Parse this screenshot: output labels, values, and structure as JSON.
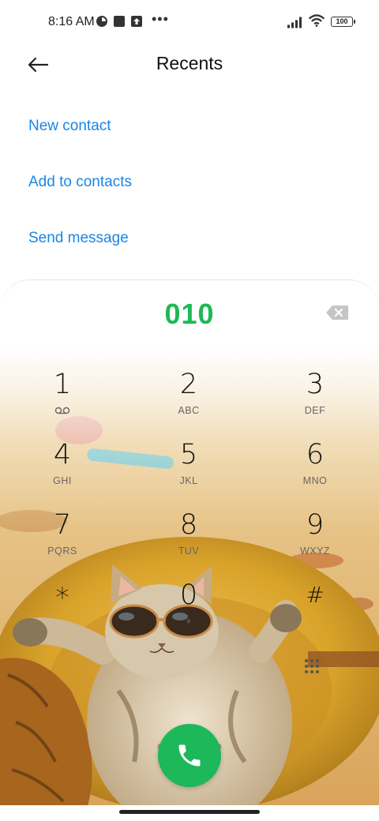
{
  "status_bar": {
    "time": "8:16 AM",
    "notification_icons": [
      "data-saver-icon",
      "square-notification-icon",
      "upload-icon"
    ],
    "more": "•••",
    "signal_icon": "cellular-signal-icon",
    "wifi_icon": "wifi-icon",
    "battery": "100"
  },
  "header": {
    "back_icon": "back-arrow-icon",
    "title": "Recents"
  },
  "actions": [
    {
      "label": "New contact"
    },
    {
      "label": "Add to contacts"
    },
    {
      "label": "Send message"
    }
  ],
  "dialer": {
    "number": "010",
    "backspace_icon": "backspace-icon",
    "keys": [
      {
        "digit": "1",
        "letters": "⌕"
      },
      {
        "digit": "2",
        "letters": "ABC"
      },
      {
        "digit": "3",
        "letters": "DEF"
      },
      {
        "digit": "4",
        "letters": "GHI"
      },
      {
        "digit": "5",
        "letters": "JKL"
      },
      {
        "digit": "6",
        "letters": "MNO"
      },
      {
        "digit": "7",
        "letters": "PQRS"
      },
      {
        "digit": "8",
        "letters": "TUV"
      },
      {
        "digit": "9",
        "letters": "WXYZ"
      },
      {
        "digit": "*",
        "letters": ""
      },
      {
        "digit": "0",
        "letters": "+"
      },
      {
        "digit": "#",
        "letters": ""
      }
    ],
    "hide_keypad_icon": "keypad-grid-icon",
    "call_icon": "phone-call-icon"
  },
  "colors": {
    "accent_link": "#1a85e6",
    "dialed_number": "#1db954",
    "call_button": "#1cb85a"
  }
}
